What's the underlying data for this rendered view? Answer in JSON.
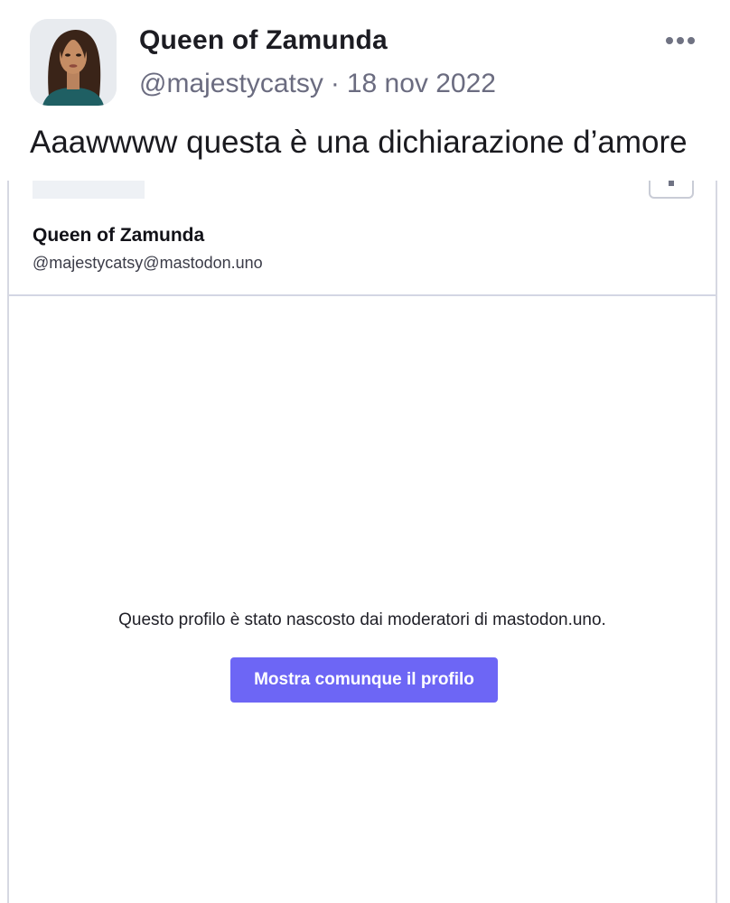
{
  "post": {
    "author_name": "Queen of Zamunda",
    "handle": "@majestycatsy",
    "separator": "·",
    "date": "18 nov 2022",
    "text": "Aaawwww questa è una dichiarazione d’amore",
    "more_icon": "ellipsis-icon"
  },
  "embed": {
    "name": "Queen of Zamunda",
    "handle": "@majestycatsy@mastodon.uno",
    "hidden_message": "Questo profilo è stato nascosto dai moderatori di mastodon.uno.",
    "show_button_label": "Mostra comunque il profilo"
  },
  "colors": {
    "accent": "#6d66f5",
    "text_primary": "#1c1c22",
    "text_secondary": "#6b6c80",
    "divider": "#d3d6e4"
  }
}
